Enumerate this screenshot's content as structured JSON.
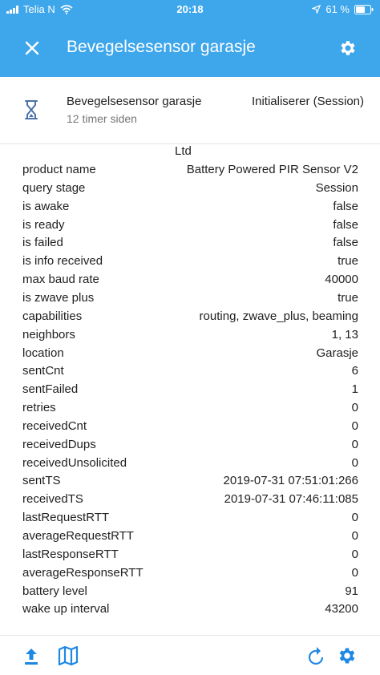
{
  "status_bar": {
    "carrier": "Telia N",
    "time": "20:18",
    "battery": "61 %"
  },
  "app_bar": {
    "title": "Bevegelsesensor garasje",
    "close_icon": "close-icon",
    "settings_icon": "gear-icon"
  },
  "node": {
    "name": "Bevegelsesensor garasje",
    "last_seen": "12 timer siden",
    "status": "Initialiserer (Session)",
    "icon": "hourglass-icon"
  },
  "attributes_cutoff": "Ltd",
  "attributes": [
    {
      "key": "product name",
      "value": "Battery Powered PIR Sensor V2"
    },
    {
      "key": "query stage",
      "value": "Session"
    },
    {
      "key": "is awake",
      "value": "false"
    },
    {
      "key": "is ready",
      "value": "false"
    },
    {
      "key": "is failed",
      "value": "false"
    },
    {
      "key": "is info received",
      "value": "true"
    },
    {
      "key": "max baud rate",
      "value": "40000"
    },
    {
      "key": "is zwave plus",
      "value": "true"
    },
    {
      "key": "capabilities",
      "value": "routing, zwave_plus, beaming"
    },
    {
      "key": "neighbors",
      "value": "1, 13"
    },
    {
      "key": "location",
      "value": "Garasje"
    },
    {
      "key": "sentCnt",
      "value": "6"
    },
    {
      "key": "sentFailed",
      "value": "1"
    },
    {
      "key": "retries",
      "value": "0"
    },
    {
      "key": "receivedCnt",
      "value": "0"
    },
    {
      "key": "receivedDups",
      "value": "0"
    },
    {
      "key": "receivedUnsolicited",
      "value": "0"
    },
    {
      "key": "sentTS",
      "value": "2019-07-31 07:51:01:266"
    },
    {
      "key": "receivedTS",
      "value": "2019-07-31 07:46:11:085"
    },
    {
      "key": "lastRequestRTT",
      "value": "0"
    },
    {
      "key": "averageRequestRTT",
      "value": "0"
    },
    {
      "key": "lastResponseRTT",
      "value": "0"
    },
    {
      "key": "averageResponseRTT",
      "value": "0"
    },
    {
      "key": "battery level",
      "value": "91"
    },
    {
      "key": "wake up interval",
      "value": "43200"
    }
  ],
  "bottom_bar": {
    "icons": [
      "upload-icon",
      "map-icon",
      "refresh-icon",
      "gear-icon"
    ]
  },
  "colors": {
    "primary": "#3ea6ea",
    "icon_blue": "#1e88e5",
    "text": "#212121",
    "secondary_text": "#757575"
  }
}
